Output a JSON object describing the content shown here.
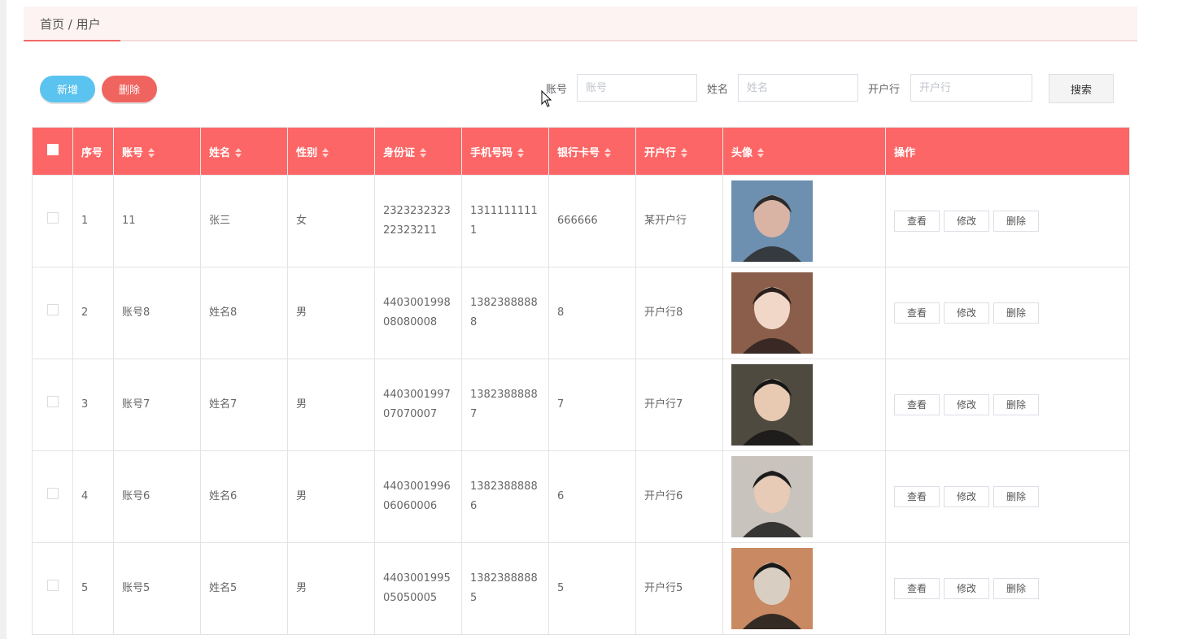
{
  "breadcrumb": {
    "text": "首页 / 用户"
  },
  "toolbar": {
    "add_label": "新增",
    "delete_label": "删除"
  },
  "search": {
    "fields": [
      {
        "label": "账号",
        "placeholder": "账号"
      },
      {
        "label": "姓名",
        "placeholder": "姓名"
      },
      {
        "label": "开户行",
        "placeholder": "开户行"
      }
    ],
    "button_label": "搜索"
  },
  "table": {
    "headers": [
      "序号",
      "账号",
      "姓名",
      "性别",
      "身份证",
      "手机号码",
      "银行卡号",
      "开户行",
      "头像",
      "操作"
    ],
    "actions": [
      "查看",
      "修改",
      "删除"
    ],
    "rows": [
      {
        "no": "1",
        "account": "11",
        "name": "张三",
        "gender": "女",
        "id_card": "232323232322323211",
        "phone": "13111111111",
        "card": "666666",
        "bank": "某开户行"
      },
      {
        "no": "2",
        "account": "账号8",
        "name": "姓名8",
        "gender": "男",
        "id_card": "440300199808080008",
        "phone": "13823888888",
        "card": "8",
        "bank": "开户行8"
      },
      {
        "no": "3",
        "account": "账号7",
        "name": "姓名7",
        "gender": "男",
        "id_card": "440300199707070007",
        "phone": "13823888887",
        "card": "7",
        "bank": "开户行7"
      },
      {
        "no": "4",
        "account": "账号6",
        "name": "姓名6",
        "gender": "男",
        "id_card": "440300199606060006",
        "phone": "13823888886",
        "card": "6",
        "bank": "开户行6"
      },
      {
        "no": "5",
        "account": "账号5",
        "name": "姓名5",
        "gender": "男",
        "id_card": "440300199505050005",
        "phone": "13823888885",
        "card": "5",
        "bank": "开户行5"
      }
    ]
  },
  "colors": {
    "accent": "#fd6666",
    "add_button": "#5bc3ef",
    "delete_button": "#f0645f"
  },
  "icons": [
    "sort-icon",
    "cursor-icon",
    "avatar-photo"
  ]
}
